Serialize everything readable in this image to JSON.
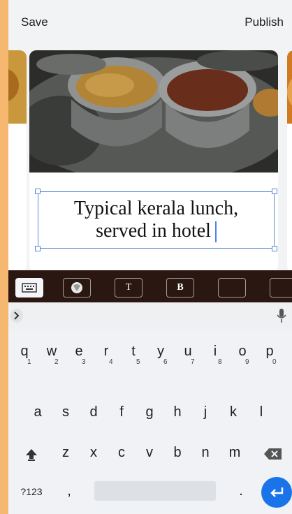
{
  "topbar": {
    "save_label": "Save",
    "publish_label": "Publish"
  },
  "caption": {
    "line1": "Typical kerala lunch,",
    "line2": "served in hotel"
  },
  "format_toolbar": {
    "text_label": "T",
    "bold_label": "B"
  },
  "keyboard": {
    "row1": [
      "q",
      "w",
      "e",
      "r",
      "t",
      "y",
      "u",
      "i",
      "o",
      "p"
    ],
    "row1_hints": [
      "1",
      "2",
      "3",
      "4",
      "5",
      "6",
      "7",
      "8",
      "9",
      "0"
    ],
    "row2": [
      "a",
      "s",
      "d",
      "f",
      "g",
      "h",
      "j",
      "k",
      "l"
    ],
    "row3": [
      "z",
      "x",
      "c",
      "v",
      "b",
      "n",
      "m"
    ],
    "symbols_label": "?123",
    "comma": ",",
    "period": "."
  },
  "icons": [
    "chevron-right-icon",
    "microphone-icon",
    "shift-icon",
    "backspace-icon",
    "enter-icon",
    "keyboard-icon",
    "wikipedia-icon"
  ]
}
